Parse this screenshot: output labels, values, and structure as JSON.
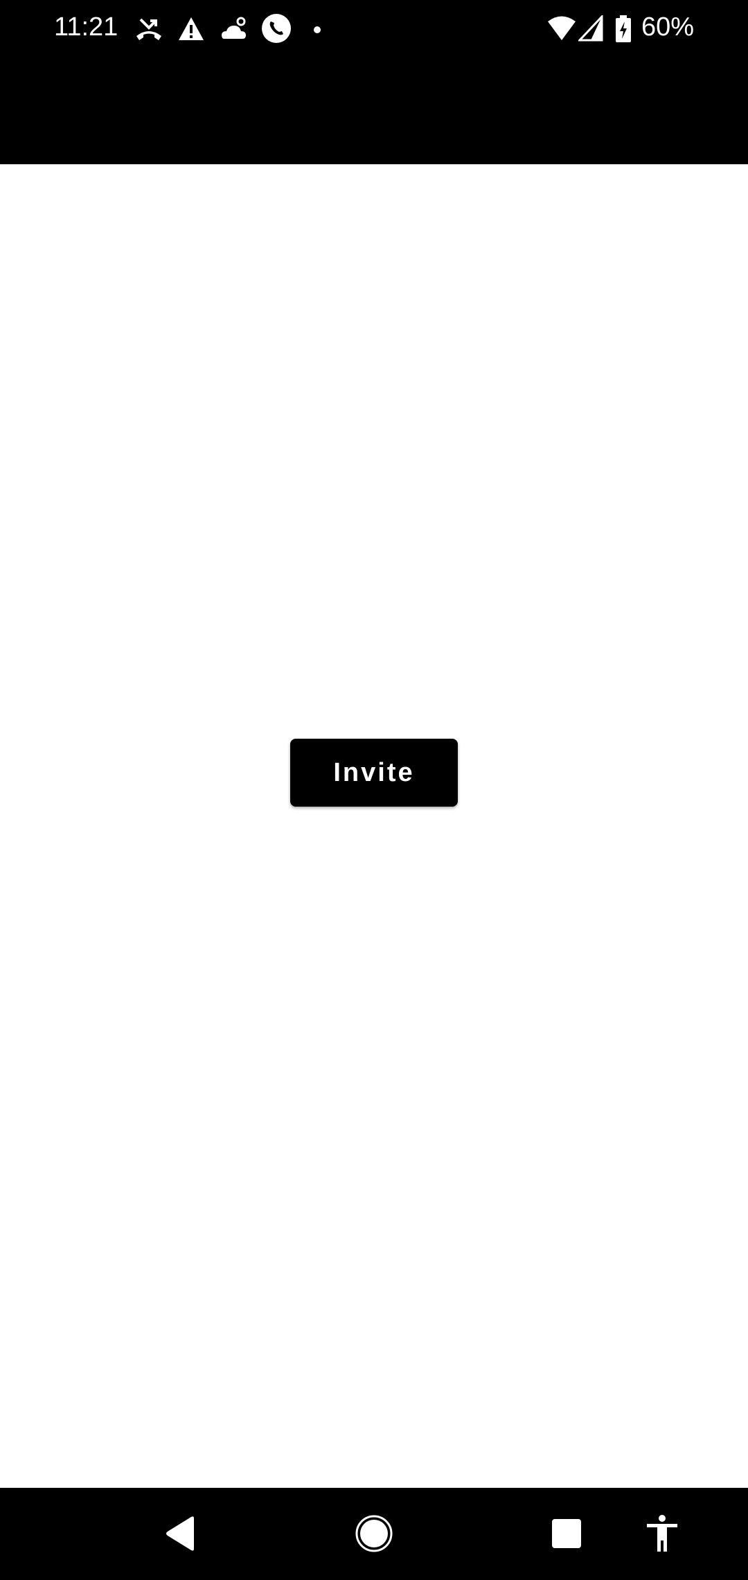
{
  "status_bar": {
    "time": "11:21",
    "battery_percent": "60%",
    "icons": [
      "missed-call-icon",
      "warning-icon",
      "weather-icon",
      "phone-call-icon",
      "dot-icon",
      "wifi-icon",
      "cell-signal-icon",
      "battery-charging-icon"
    ]
  },
  "main": {
    "invite_button_label": "Invite"
  },
  "nav_bar": {
    "buttons": [
      "back-icon",
      "home-icon",
      "recents-icon",
      "accessibility-icon"
    ]
  },
  "colors": {
    "background": "#ffffff",
    "bars": "#000000",
    "button": "#000000",
    "button_text": "#ffffff"
  }
}
